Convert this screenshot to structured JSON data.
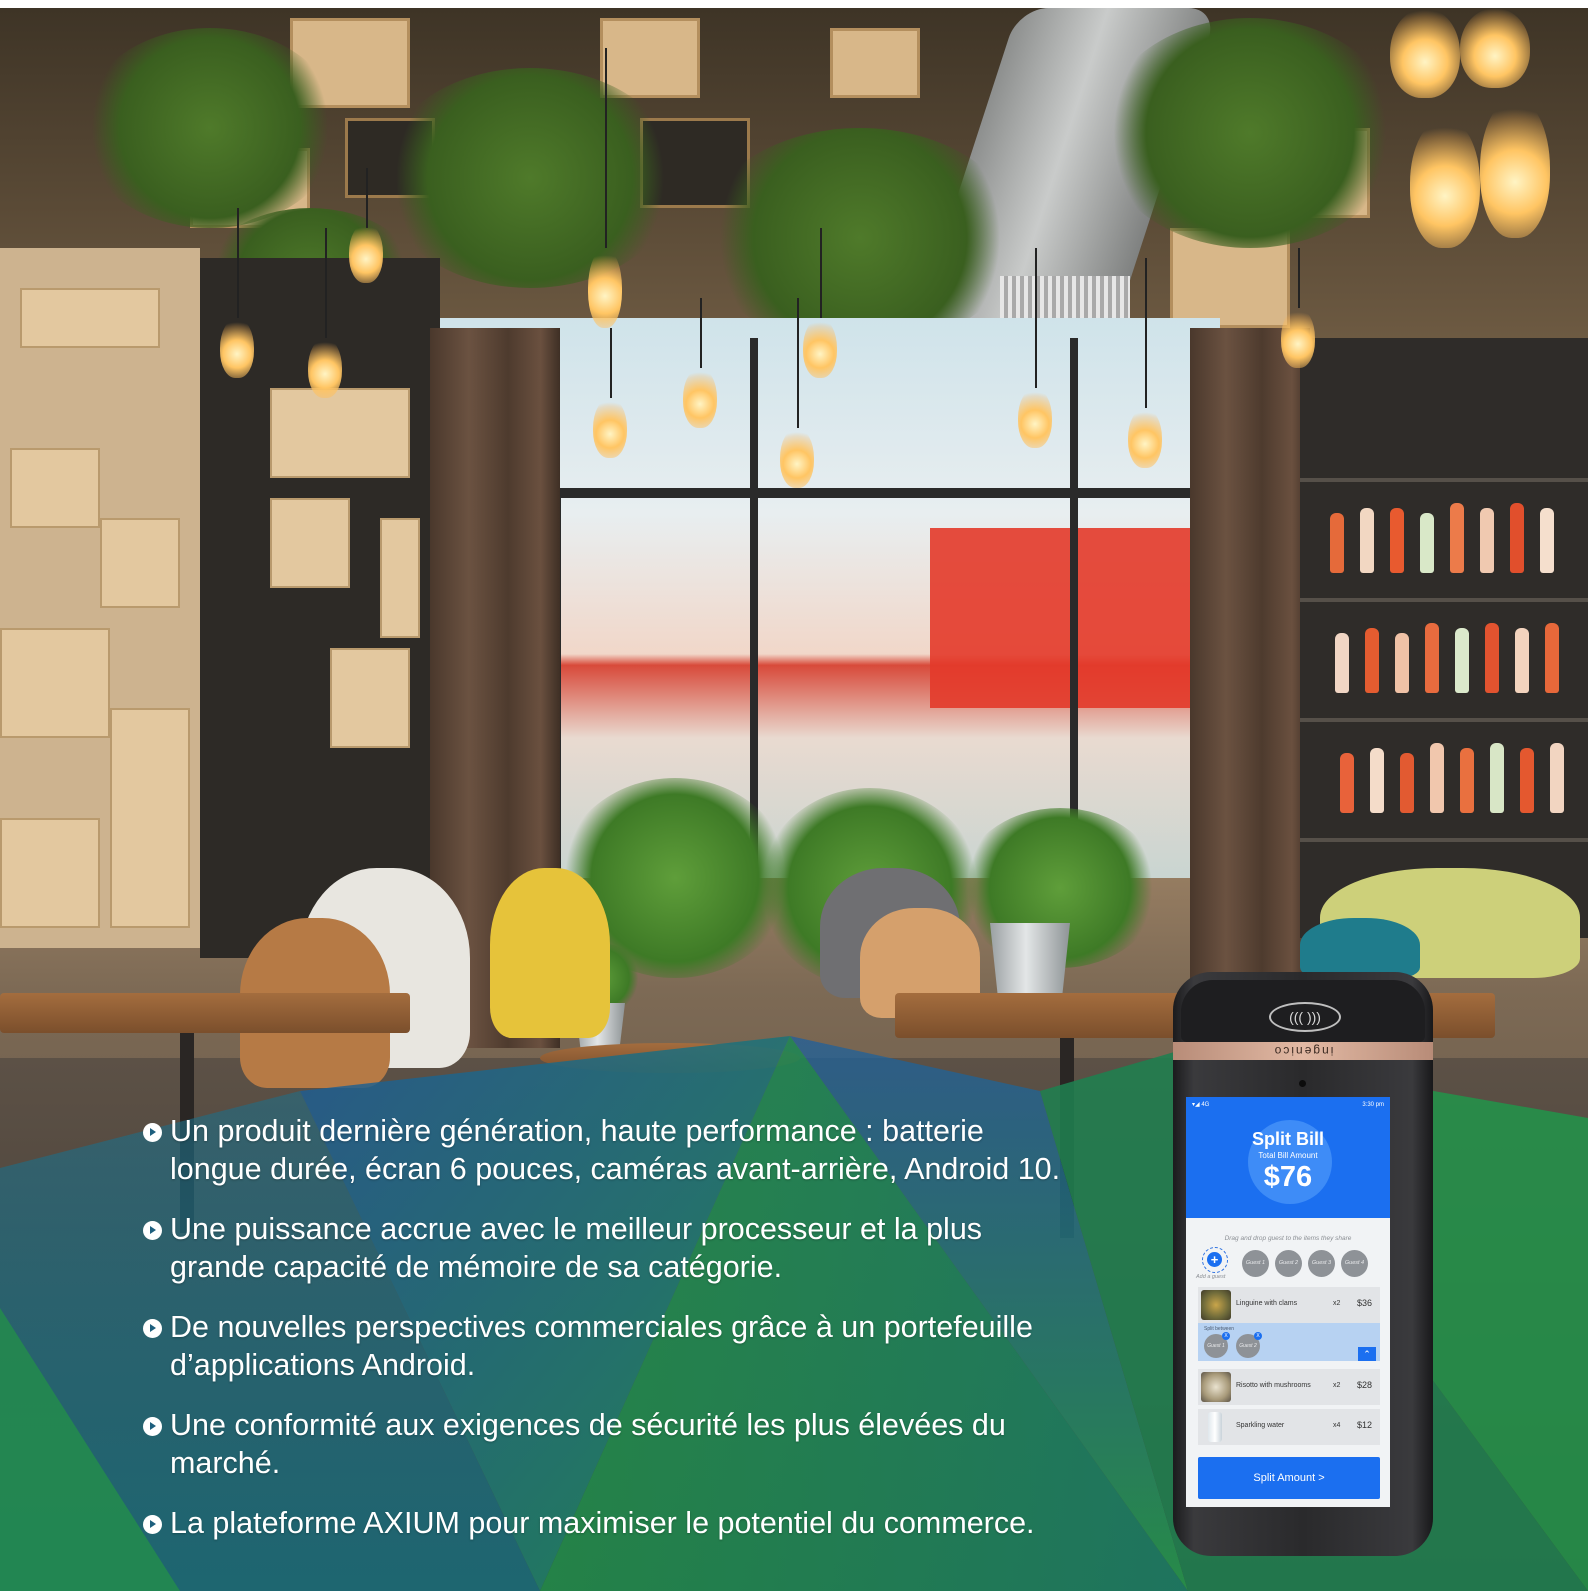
{
  "colors": {
    "overlay_teal": "#1d6a86",
    "overlay_green": "#1f8a4c",
    "overlay_blue": "#1e4f8c",
    "text": "#ffffff",
    "app_blue": "#1b6ff0"
  },
  "bullets": [
    {
      "icon": "arrow-circle-icon",
      "line1": "Un produit dernière génération, haute performance : batterie",
      "line2": "longue durée, écran 6 pouces, caméras avant-arrière, Android 10."
    },
    {
      "icon": "arrow-circle-icon",
      "line1": "Une puissance accrue avec le meilleur processeur et la plus",
      "line2": "grande capacité de mémoire de sa catégorie."
    },
    {
      "icon": "arrow-circle-icon",
      "line1": "De nouvelles perspectives commerciales grâce à un portefeuille",
      "line2": "d’applications Android."
    },
    {
      "icon": "arrow-circle-icon",
      "line1": "Une conformité aux exigences de sécurité les plus élevées du",
      "line2": "marché."
    },
    {
      "icon": "arrow-circle-icon",
      "line1": "La plateforme AXIUM pour maximiser le potentiel du commerce.",
      "line2": ""
    }
  ],
  "device": {
    "brand": "ingenico",
    "contactless_icon": "contactless-icon",
    "app": {
      "status_time": "3:30 pm",
      "status_network": "4G",
      "title": "Split Bill",
      "total_label": "Total Bill Amount",
      "total_amount": "$76",
      "hint": "Drag and drop guest to the items they share",
      "add_guest_label": "Add a guest",
      "guests": [
        "Guest 1",
        "Guest 2",
        "Guest 3",
        "Guest 4"
      ],
      "items": [
        {
          "name": "Linguine with clams",
          "qty": "x2",
          "price": "$36"
        },
        {
          "name": "Risotto with mushrooms",
          "qty": "x2",
          "price": "$28"
        },
        {
          "name": "Sparkling water",
          "qty": "x4",
          "price": "$12"
        }
      ],
      "split_between_label": "Split between",
      "split_guests": [
        "Guest 1",
        "Guest 2"
      ],
      "split_badges": [
        "X",
        "X"
      ],
      "collapse_glyph": "⌃",
      "cta_label": "Split Amount >"
    }
  }
}
